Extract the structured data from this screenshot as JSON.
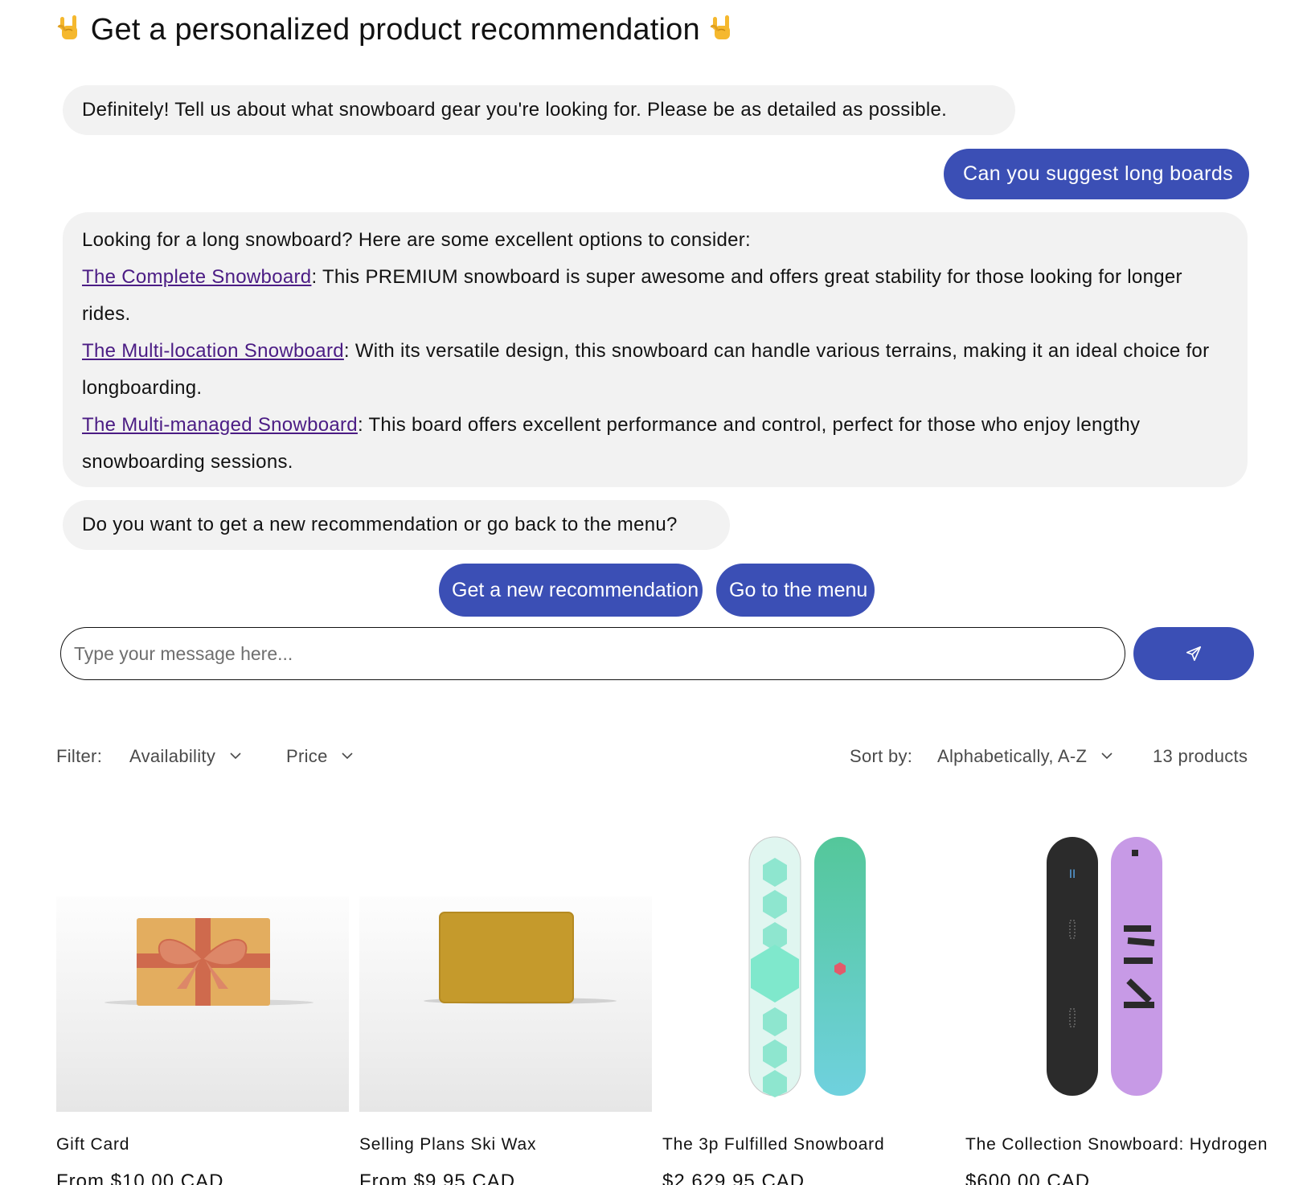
{
  "header": {
    "title": "Get a personalized product recommendation",
    "emoji_icon": "sign-of-the-horns-icon"
  },
  "chat": {
    "bot_intro": "Definitely! Tell us about what snowboard gear you're looking for. Please be as detailed as possible.",
    "user_message": "Can you suggest long boards",
    "bot_reply": {
      "intro": "Looking for a long snowboard? Here are some excellent options to consider:",
      "items": [
        {
          "link": "The Complete Snowboard",
          "text": ": This PREMIUM snowboard is super awesome and offers great stability for those looking for longer rides."
        },
        {
          "link": "The Multi-location Snowboard",
          "text": ": With its versatile design, this snowboard can handle various terrains, making it an ideal choice for longboarding."
        },
        {
          "link": "The Multi-managed Snowboard",
          "text": ": This board offers excellent performance and control, perfect for those who enjoy lengthy snowboarding sessions."
        }
      ]
    },
    "bot_question": "Do you want to get a new recommendation or go back to the menu?",
    "options": [
      "Get a new recommendation",
      "Go to the menu"
    ],
    "input": {
      "placeholder": "Type your message here...",
      "value": ""
    },
    "send_icon": "send-icon"
  },
  "collection": {
    "filter_label": "Filter:",
    "filters": [
      "Availability",
      "Price"
    ],
    "sort_label": "Sort by:",
    "sort_value": "Alphabetically, A-Z",
    "count": "13 products",
    "products": [
      {
        "name": "Gift Card",
        "price": "From $10.00 CAD"
      },
      {
        "name": "Selling Plans Ski Wax",
        "price": "From $9.95 CAD"
      },
      {
        "name": "The 3p Fulfilled Snowboard",
        "price": "$2,629.95 CAD"
      },
      {
        "name": "The Collection Snowboard: Hydrogen",
        "price": "$600.00 CAD"
      }
    ]
  },
  "colors": {
    "accent": "#3b4fb5",
    "bubble_bg": "#f2f2f2",
    "link": "#4b1c84"
  }
}
